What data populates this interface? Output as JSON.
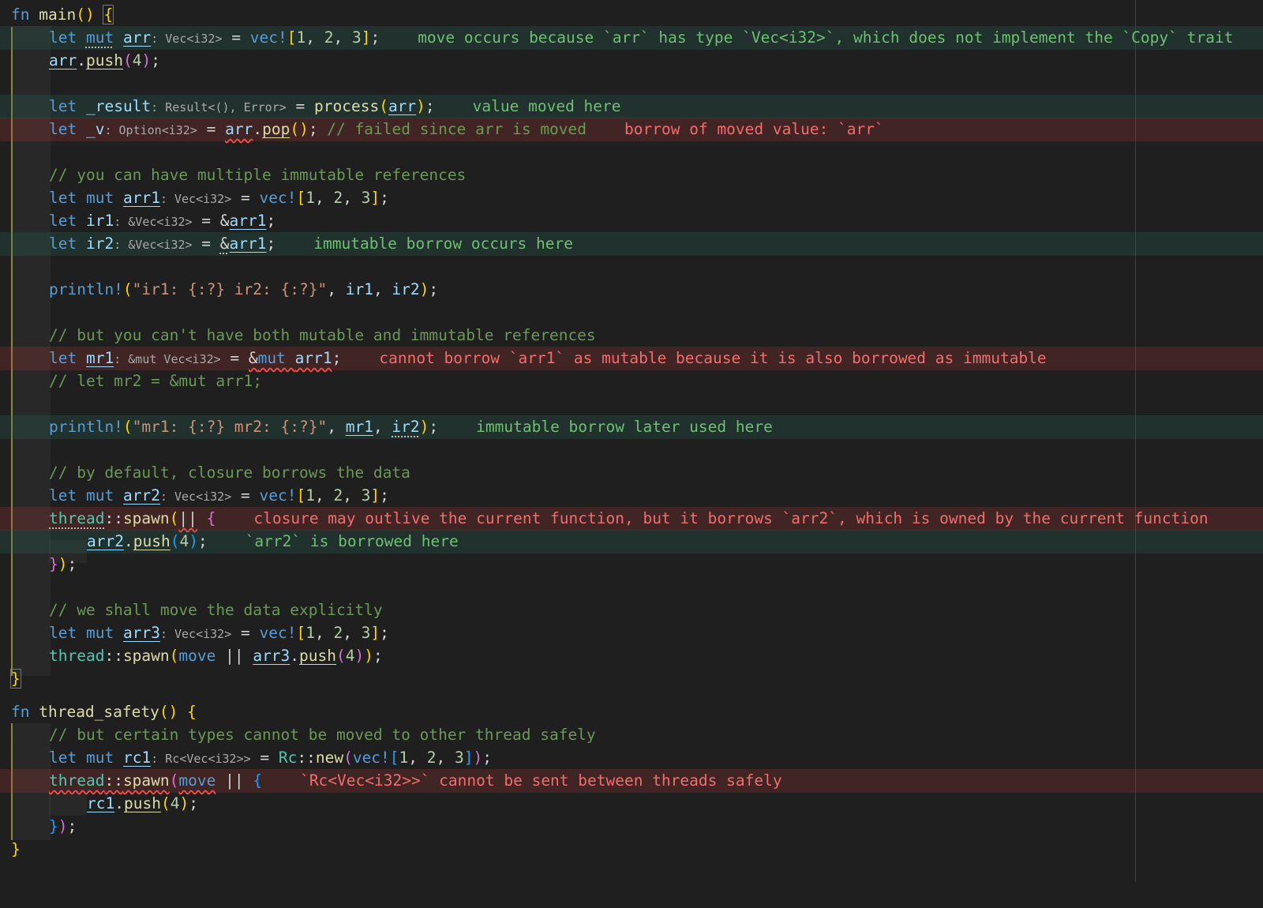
{
  "editor": {
    "language": "rust",
    "theme_colors": {
      "background": "#1f1f1f",
      "error_line": "#3a2424",
      "info_line": "#1e3430",
      "error_text": "#f26d6d",
      "info_text": "#6fbf73",
      "comment": "#6a9955",
      "keyword": "#569cd6",
      "function": "#dcdcaa",
      "type": "#4ec9b0",
      "number": "#b5cea8",
      "string": "#ce9178"
    },
    "diagnostics": {
      "move_occurs": "move occurs because `arr` has type `Vec<i32>`, which does not implement the `Copy` trait",
      "value_moved": "value moved here",
      "borrow_moved": "borrow of moved value: `arr`",
      "immutable_borrow": "immutable borrow occurs here",
      "cannot_borrow_mut": "cannot borrow `arr1` as mutable because it is also borrowed as immutable",
      "immutable_later": "immutable borrow later used here",
      "closure_outlive": "closure may outlive the current function, but it borrows `arr2`, which is owned by the current function",
      "arr2_borrowed": "`arr2` is borrowed here",
      "rc_not_send": "`Rc<Vec<i32>>` cannot be sent between threads safely"
    },
    "comments": {
      "failed_moved": "// failed since arr is moved",
      "multiple_immutable": "// you can have multiple immutable references",
      "not_both": "// but you can't have both mutable and immutable references",
      "let_mr2": "// let mr2 = &mut arr1;",
      "closure_borrows": "// by default, closure borrows the data",
      "move_explicitly": "// we shall move the data explicitly",
      "certain_types": "// but certain types cannot be moved to other thread safely"
    },
    "hints": {
      "vec_i32": "Vec<i32>",
      "result": "Result<(), Error>",
      "option": "Option<i32>",
      "ref_vec": "&Vec<i32>",
      "mut_vec": "&mut Vec<i32>",
      "rc_vec": "Rc<Vec<i32>>"
    },
    "strings": {
      "ir_fmt": "\"ir1: {:?} ir2: {:?}\"",
      "mr_fmt": "\"mr1: {:?} mr2: {:?}\""
    }
  }
}
